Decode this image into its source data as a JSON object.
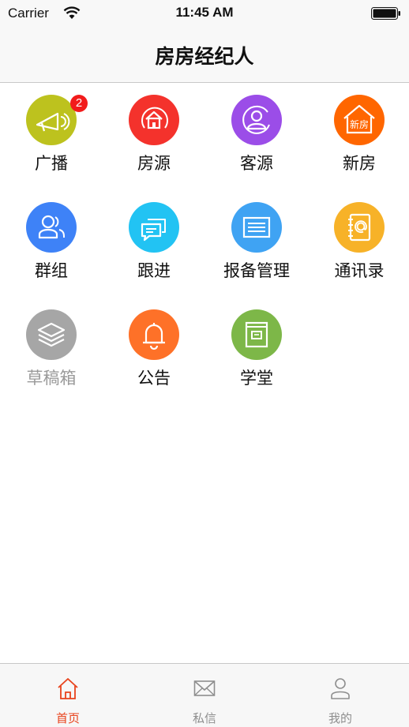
{
  "status_bar": {
    "carrier": "Carrier",
    "time": "11:45 AM"
  },
  "header": {
    "title": "房房经纪人"
  },
  "grid": {
    "items": [
      {
        "label": "广播",
        "icon": "megaphone-icon",
        "color": "#bdc21e",
        "badge": "2"
      },
      {
        "label": "房源",
        "icon": "house-source-icon",
        "color": "#f4322c"
      },
      {
        "label": "客源",
        "icon": "client-icon",
        "color": "#9b4de8"
      },
      {
        "label": "新房",
        "icon": "new-house-icon",
        "color": "#ff6600",
        "icon_text": "新房"
      },
      {
        "label": "群组",
        "icon": "group-icon",
        "color": "#3e82f7"
      },
      {
        "label": "跟进",
        "icon": "follow-up-icon",
        "color": "#22c3f3"
      },
      {
        "label": "报备管理",
        "icon": "report-icon",
        "color": "#3fa3f3"
      },
      {
        "label": "通讯录",
        "icon": "contacts-icon",
        "color": "#f7b228"
      },
      {
        "label": "草稿箱",
        "icon": "drafts-icon",
        "color": "#a6a6a6"
      },
      {
        "label": "公告",
        "icon": "bell-icon",
        "color": "#fe7128"
      },
      {
        "label": "学堂",
        "icon": "classroom-icon",
        "color": "#7db748"
      }
    ]
  },
  "tabbar": {
    "items": [
      {
        "label": "首页",
        "icon": "home-icon",
        "active": true
      },
      {
        "label": "私信",
        "icon": "mail-icon"
      },
      {
        "label": "我的",
        "icon": "profile-icon"
      }
    ],
    "active_color": "#e8431c"
  }
}
